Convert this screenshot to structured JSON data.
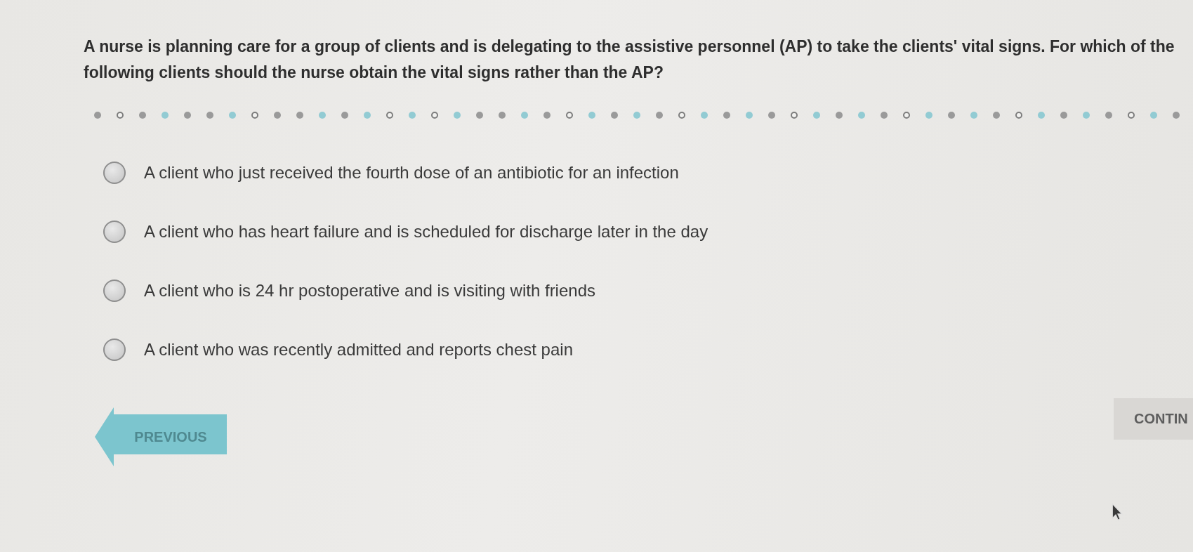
{
  "question": {
    "text": "A nurse is planning care for a group of clients and is delegating to the assistive personnel (AP) to take the clients' vital signs. For which of the following clients should the nurse obtain the vital signs rather than the AP?"
  },
  "progress": {
    "dots": [
      {
        "kind": "dot",
        "color": "#9a9a9a"
      },
      {
        "kind": "ring",
        "color": "#7d7d7d"
      },
      {
        "kind": "dot",
        "color": "#9a9a9a"
      },
      {
        "kind": "dot",
        "color": "#92cbd3"
      },
      {
        "kind": "dot",
        "color": "#9a9a9a"
      },
      {
        "kind": "dot",
        "color": "#9a9a9a"
      },
      {
        "kind": "dot",
        "color": "#92cbd3"
      },
      {
        "kind": "ring",
        "color": "#7d7d7d"
      },
      {
        "kind": "dot",
        "color": "#9a9a9a"
      },
      {
        "kind": "dot",
        "color": "#9a9a9a"
      },
      {
        "kind": "dot",
        "color": "#92cbd3"
      },
      {
        "kind": "dot",
        "color": "#9a9a9a"
      },
      {
        "kind": "dot",
        "color": "#92cbd3"
      },
      {
        "kind": "ring",
        "color": "#7d7d7d"
      },
      {
        "kind": "dot",
        "color": "#92cbd3"
      },
      {
        "kind": "ring",
        "color": "#7d7d7d"
      },
      {
        "kind": "dot",
        "color": "#92cbd3"
      },
      {
        "kind": "dot",
        "color": "#9a9a9a"
      },
      {
        "kind": "dot",
        "color": "#9a9a9a"
      },
      {
        "kind": "dot",
        "color": "#92cbd3"
      },
      {
        "kind": "dot",
        "color": "#9a9a9a"
      },
      {
        "kind": "ring",
        "color": "#7d7d7d"
      },
      {
        "kind": "dot",
        "color": "#92cbd3"
      },
      {
        "kind": "dot",
        "color": "#9a9a9a"
      },
      {
        "kind": "dot",
        "color": "#92cbd3"
      },
      {
        "kind": "dot",
        "color": "#9a9a9a"
      },
      {
        "kind": "ring",
        "color": "#7d7d7d"
      },
      {
        "kind": "dot",
        "color": "#92cbd3"
      },
      {
        "kind": "dot",
        "color": "#9a9a9a"
      },
      {
        "kind": "dot",
        "color": "#92cbd3"
      },
      {
        "kind": "dot",
        "color": "#9a9a9a"
      },
      {
        "kind": "ring",
        "color": "#7d7d7d"
      },
      {
        "kind": "dot",
        "color": "#92cbd3"
      },
      {
        "kind": "dot",
        "color": "#9a9a9a"
      },
      {
        "kind": "dot",
        "color": "#92cbd3"
      },
      {
        "kind": "dot",
        "color": "#9a9a9a"
      },
      {
        "kind": "ring",
        "color": "#7d7d7d"
      },
      {
        "kind": "dot",
        "color": "#92cbd3"
      },
      {
        "kind": "dot",
        "color": "#9a9a9a"
      },
      {
        "kind": "dot",
        "color": "#92cbd3"
      },
      {
        "kind": "dot",
        "color": "#9a9a9a"
      },
      {
        "kind": "ring",
        "color": "#7d7d7d"
      },
      {
        "kind": "dot",
        "color": "#92cbd3"
      },
      {
        "kind": "dot",
        "color": "#9a9a9a"
      },
      {
        "kind": "dot",
        "color": "#92cbd3"
      },
      {
        "kind": "dot",
        "color": "#9a9a9a"
      },
      {
        "kind": "ring",
        "color": "#7d7d7d"
      },
      {
        "kind": "dot",
        "color": "#92cbd3"
      },
      {
        "kind": "dot",
        "color": "#9a9a9a"
      }
    ]
  },
  "options": [
    {
      "label": "A client who just received the fourth dose of an antibiotic for an infection",
      "selected": false
    },
    {
      "label": "A client who has heart failure and is scheduled for discharge later in the day",
      "selected": false
    },
    {
      "label": "A client who is 24 hr postoperative and is visiting with friends",
      "selected": false
    },
    {
      "label": "A client who was recently admitted and reports chest pain",
      "selected": false
    }
  ],
  "buttons": [
    {
      "kind": "previous",
      "label": "PREVIOUS"
    },
    {
      "kind": "continue",
      "label": "CONTIN"
    }
  ]
}
